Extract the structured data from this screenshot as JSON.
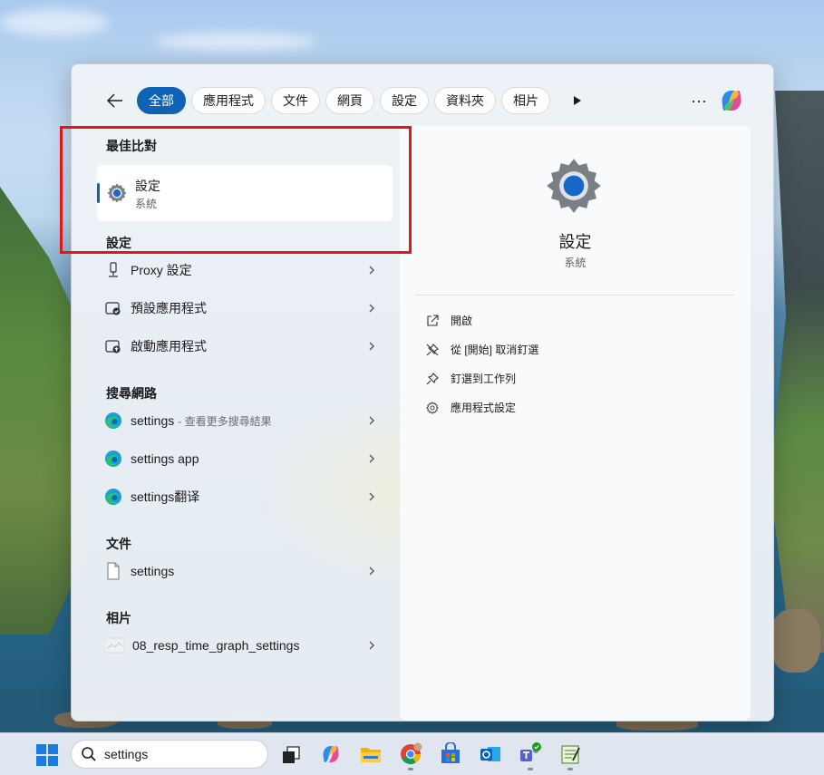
{
  "tabs": [
    {
      "label": "全部",
      "active": true
    },
    {
      "label": "應用程式"
    },
    {
      "label": "文件"
    },
    {
      "label": "網頁"
    },
    {
      "label": "設定"
    },
    {
      "label": "資料夾"
    },
    {
      "label": "相片"
    }
  ],
  "more_label": "···",
  "sections": {
    "best_match": "最佳比對",
    "settings": "設定",
    "web": "搜尋網路",
    "documents": "文件",
    "photos": "相片"
  },
  "best_match": {
    "title": "設定",
    "subtitle": "系統"
  },
  "settings_results": [
    {
      "label": "Proxy 設定",
      "icon": "proxy-icon"
    },
    {
      "label": "預設應用程式",
      "icon": "default-apps-icon"
    },
    {
      "label": "啟動應用程式",
      "icon": "startup-apps-icon"
    }
  ],
  "web_results": [
    {
      "label": "settings",
      "suffix": "- 查看更多搜尋結果",
      "icon": "edge-icon"
    },
    {
      "label": "settings app",
      "icon": "edge-icon"
    },
    {
      "label": "settings翻译",
      "icon": "edge-icon"
    }
  ],
  "document_results": [
    {
      "label": "settings",
      "icon": "document-icon"
    }
  ],
  "photo_results": [
    {
      "label": "08_resp_time_graph_settings",
      "icon": "image-thumbnail"
    }
  ],
  "detail": {
    "title": "設定",
    "subtitle": "系統",
    "actions": [
      {
        "label": "開啟",
        "icon": "open-external-icon"
      },
      {
        "label": "從 [開始] 取消釘選",
        "icon": "unpin-icon"
      },
      {
        "label": "釘選到工作列",
        "icon": "pin-icon"
      },
      {
        "label": "應用程式設定",
        "icon": "gear-icon"
      }
    ]
  },
  "taskbar": {
    "search_value": "settings",
    "apps": [
      "task-view-icon",
      "copilot-icon",
      "file-explorer-icon",
      "chrome-icon",
      "store-icon",
      "outlook-icon",
      "teams-icon",
      "notepad-icon"
    ]
  },
  "colors": {
    "accent": "#0f62b4",
    "highlight": "#e0181a"
  }
}
